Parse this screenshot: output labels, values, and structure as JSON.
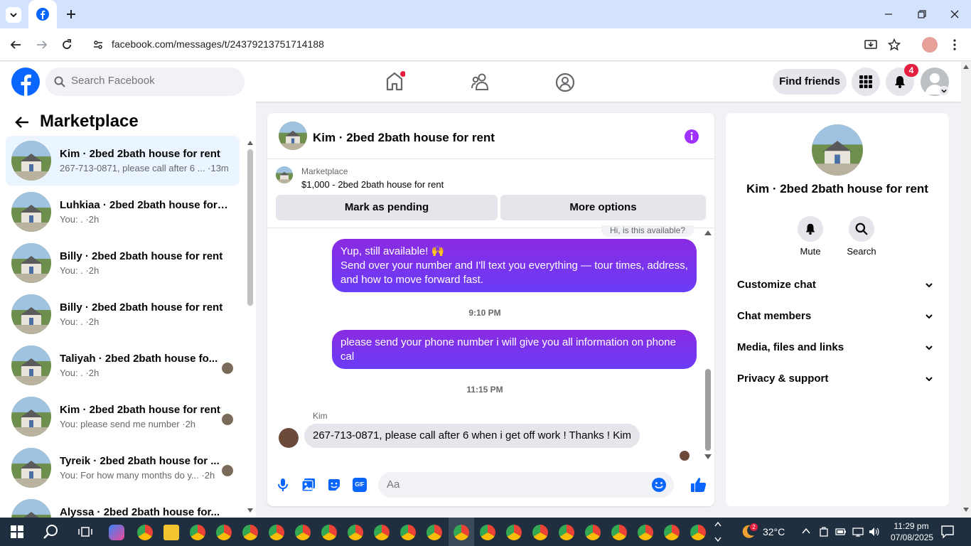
{
  "browser": {
    "url": "facebook.com/messages/t/24379213751714188"
  },
  "header": {
    "search_placeholder": "Search Facebook",
    "find_friends_label": "Find friends",
    "notification_count": "4"
  },
  "sidebar": {
    "title": "Marketplace",
    "conversations": [
      {
        "name": "Kim · 2bed 2bath house for rent",
        "snippet": "267-713-0871, please call after 6 ... ·13m"
      },
      {
        "name": "Luhkiaa · 2bed 2bath house for r...",
        "snippet": "You: . ·2h"
      },
      {
        "name": "Billy · 2bed 2bath house for rent",
        "snippet": "You: . ·2h"
      },
      {
        "name": "Billy · 2bed 2bath house for rent",
        "snippet": "You: . ·2h"
      },
      {
        "name": "Taliyah · 2bed 2bath house fo...",
        "snippet": "You: . ·2h"
      },
      {
        "name": "Kim · 2bed 2bath house for rent",
        "snippet": "You: please send me number ·2h"
      },
      {
        "name": "Tyreik · 2bed 2bath house for ...",
        "snippet": "You: For how many months do y... ·2h"
      },
      {
        "name": "Alyssa · 2bed 2bath house for...",
        "snippet": ""
      }
    ]
  },
  "chat": {
    "title": "Kim · 2bed 2bath house for rent",
    "listing_label": "Marketplace",
    "listing_title": "$1,000 - 2bed 2bath house for rent",
    "mark_pending_label": "Mark as pending",
    "more_options_label": "More options",
    "partial_message": "Hi, is this available?",
    "message_1_line1": "Yup, still available! 🙌",
    "message_1_line2": "Send over your number and I'll text you everything — tour times, address, and how to move forward fast.",
    "time_1": "9:10 PM",
    "message_2": "please send your phone number i will give you all information on phone cal",
    "time_2": "11:15 PM",
    "sender_name": "Kim",
    "message_3": "267-713-0871, please call after 6 when i get off work ! Thanks ! Kim",
    "composer_placeholder": "Aa",
    "gif_label": "GIF"
  },
  "info_panel": {
    "name": "Kim · 2bed 2bath house for rent",
    "mute_label": "Mute",
    "search_label": "Search",
    "sections": [
      "Customize chat",
      "Chat members",
      "Media, files and links",
      "Privacy & support"
    ]
  },
  "taskbar": {
    "weather": "32°C",
    "weather_badge": "2",
    "time": "11:29 pm",
    "date": "07/08/2025"
  },
  "colors": {
    "brand": "#0866ff",
    "bubble": "#7b2ff7",
    "notification": "#e41e3f"
  }
}
